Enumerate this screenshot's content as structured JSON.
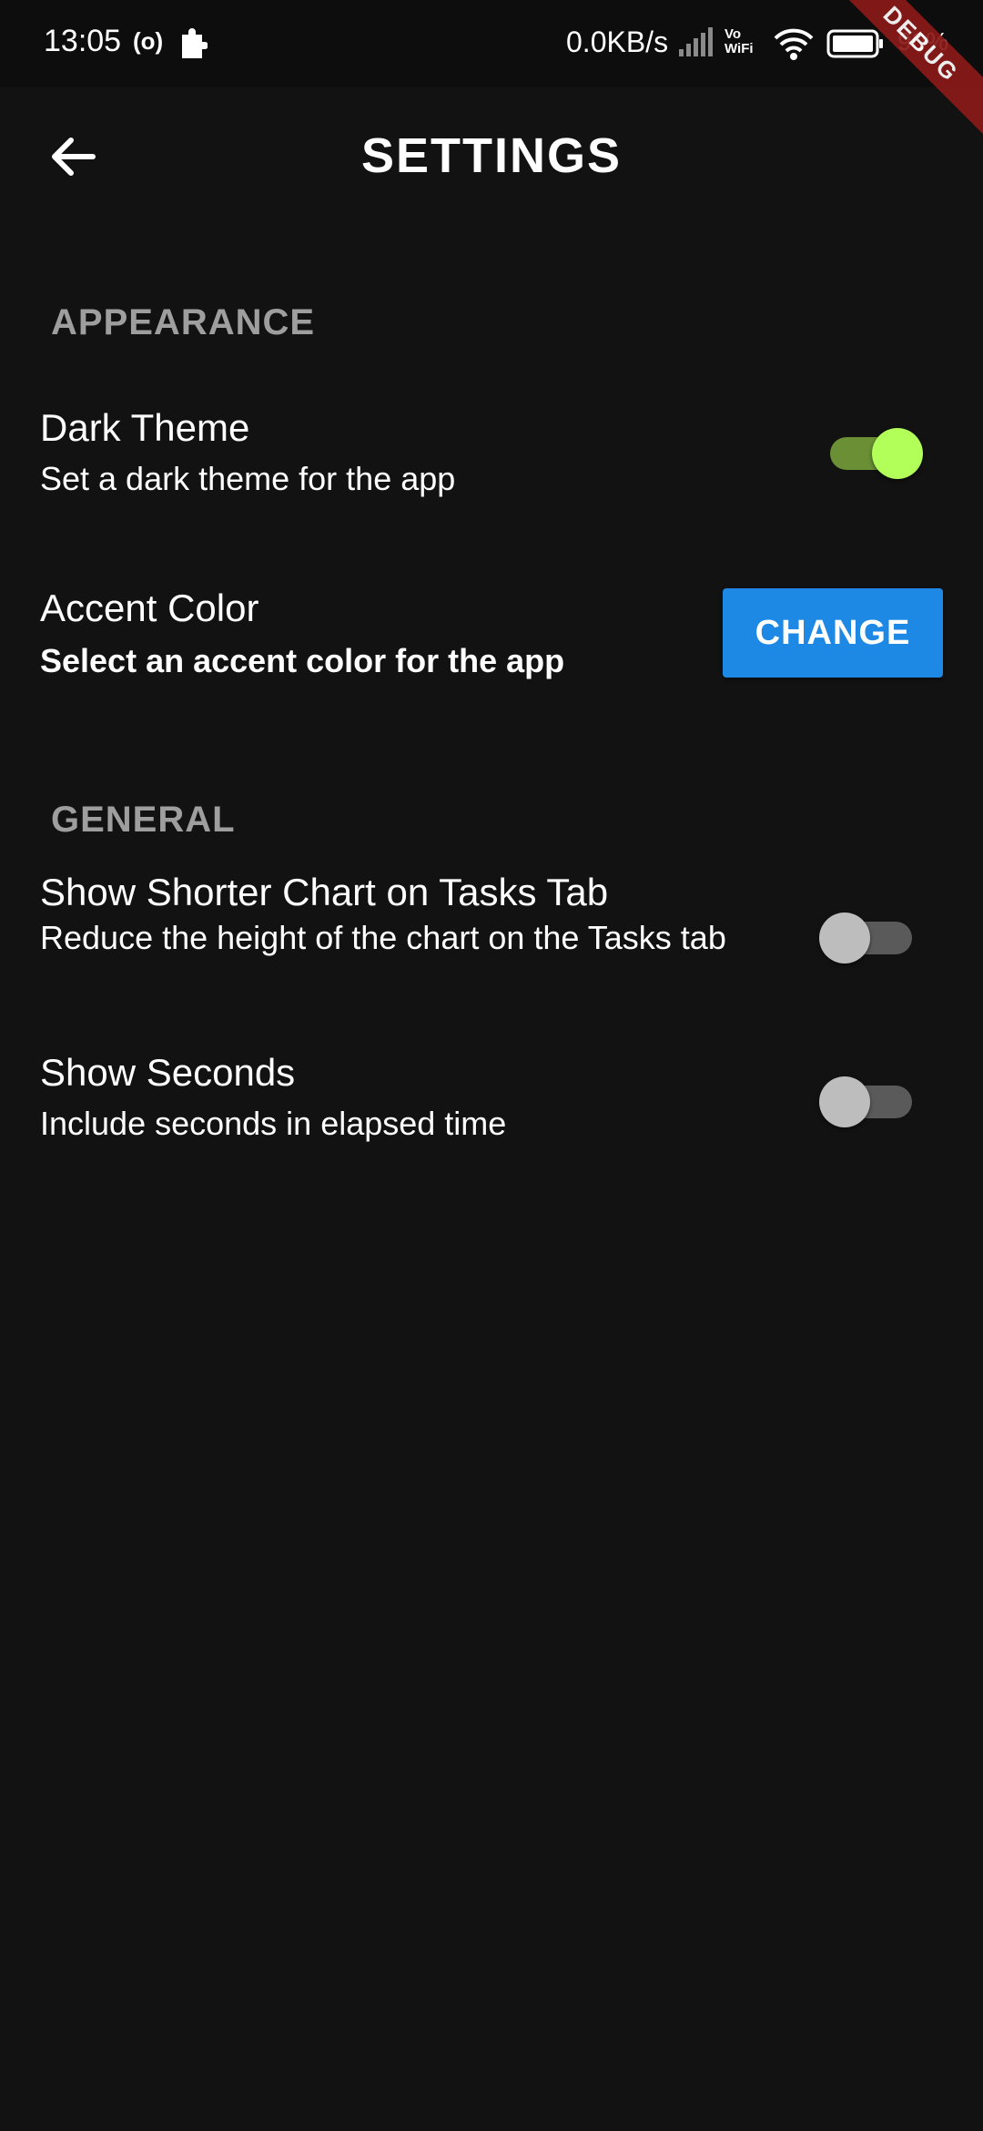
{
  "status_bar": {
    "time": "13:05",
    "radio_glyph": "(o)",
    "net_speed": "0.0KB/s",
    "vowifi_line1": "Vo",
    "vowifi_line2": "WiFi",
    "battery": "90%"
  },
  "debug_banner": "DEBUG",
  "app_bar": {
    "title": "SETTINGS",
    "back_icon": "arrow-back-icon"
  },
  "sections": {
    "appearance": {
      "header": "APPEARANCE",
      "dark_theme": {
        "title": "Dark Theme",
        "subtitle": "Set a dark theme for the app",
        "enabled": true
      },
      "accent_color": {
        "title": "Accent Color",
        "subtitle": "Select an accent color for the app",
        "button_label": "CHANGE"
      }
    },
    "general": {
      "header": "GENERAL",
      "shorter_chart": {
        "title": "Show Shorter Chart on Tasks Tab",
        "subtitle": "Reduce the height of the chart on the Tasks tab",
        "enabled": false
      },
      "show_seconds": {
        "title": "Show Seconds",
        "subtitle": "Include seconds in elapsed time",
        "enabled": false
      }
    }
  },
  "colors": {
    "background": "#121212",
    "section_header": "#9e9e9e",
    "toggle_on_thumb": "#b2ff59",
    "toggle_on_track": "#6a8f35",
    "button": "#1e88e5",
    "debug_banner": "#8b1a1a"
  }
}
